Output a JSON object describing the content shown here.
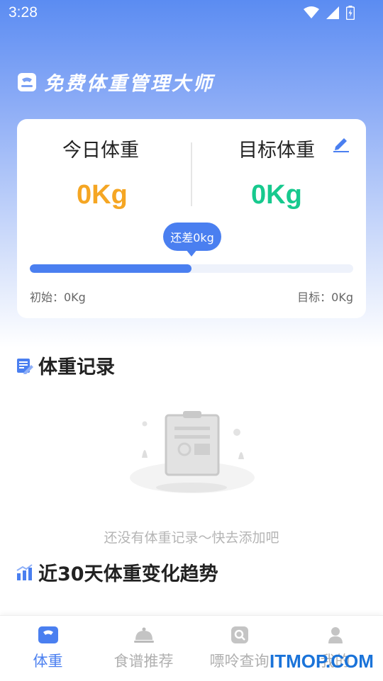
{
  "status_bar": {
    "time": "3:28"
  },
  "header": {
    "app_title": "免费体重管理大师"
  },
  "weight_card": {
    "today_label": "今日体重",
    "today_value": "0Kg",
    "target_label": "目标体重",
    "target_value": "0Kg",
    "remaining_bubble": "还差0kg",
    "progress_fraction": 0.5,
    "initial_label": "初始：0Kg",
    "goal_label": "目标：0Kg"
  },
  "records": {
    "title": "体重记录",
    "empty_text": "还没有体重记录～快去添加吧"
  },
  "trend": {
    "title": "近30天体重变化趋势"
  },
  "tabbar": {
    "tabs": [
      {
        "label": "体重",
        "icon": "scale-icon",
        "active": true
      },
      {
        "label": "食谱推荐",
        "icon": "cloche-icon",
        "active": false
      },
      {
        "label": "嘌呤查询",
        "icon": "search-icon",
        "active": false
      },
      {
        "label": "我的",
        "icon": "user-icon",
        "active": false
      }
    ]
  },
  "watermark": "ITMOP.COM",
  "colors": {
    "accent": "#4a7ff0",
    "today_value": "#f5a623",
    "target_value": "#17c98e"
  }
}
